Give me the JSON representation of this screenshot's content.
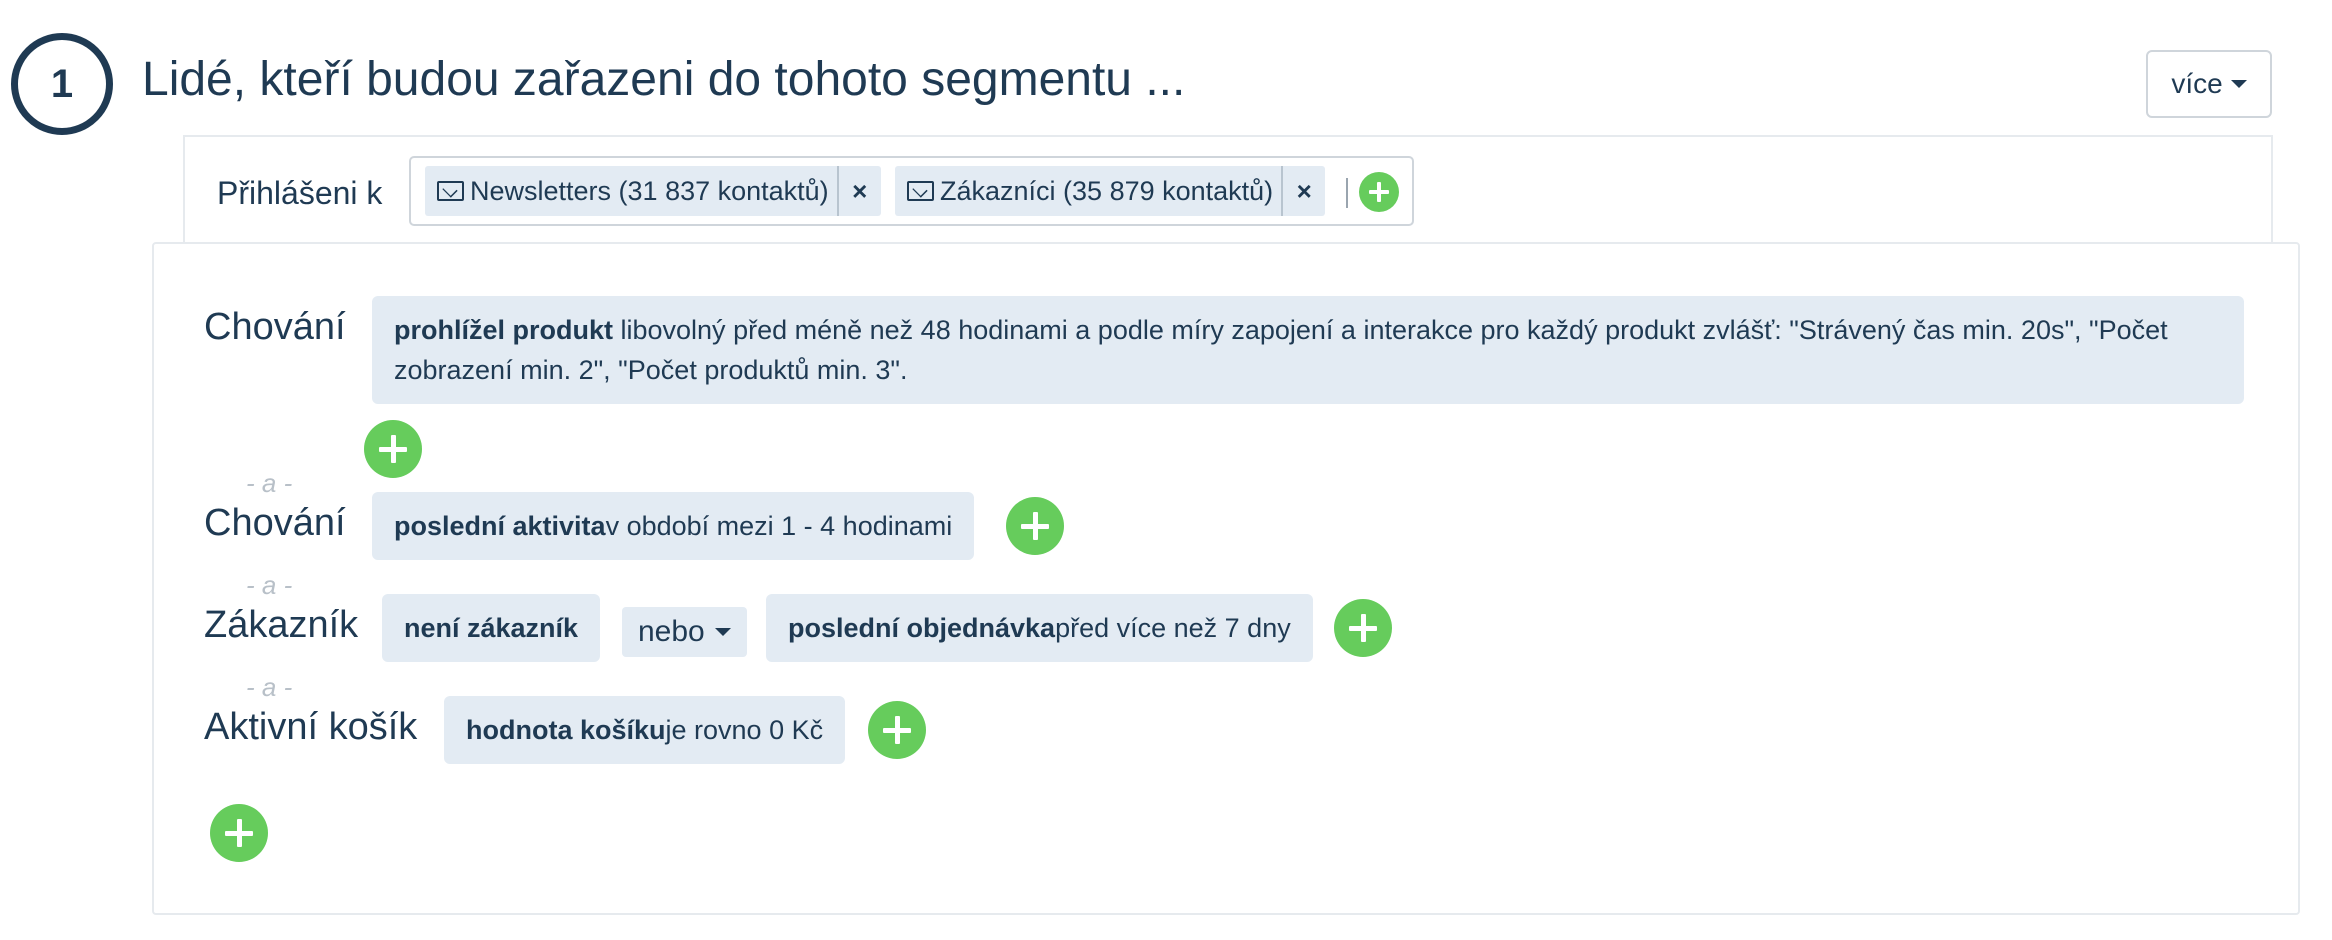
{
  "step": {
    "number": "1",
    "title": "Lidé, kteří budou zařazeni do tohoto segmentu ..."
  },
  "more_button": {
    "label": "více",
    "icon": "caret-down-icon"
  },
  "subscribed": {
    "label": "Přihlášeni k",
    "tags": [
      {
        "label": "Newsletters (31 837 kontaktů)",
        "icon": "envelope-icon",
        "remove": "×"
      },
      {
        "label": "Zákazníci (35 879 kontaktů)",
        "icon": "envelope-icon",
        "remove": "×"
      }
    ]
  },
  "conditions": [
    {
      "label": "Chování",
      "chips": [
        {
          "bold": "prohlížel produkt",
          "rest": " libovolný před méně než 48 hodinami a podle míry zapojení a interakce pro každý produkt zvlášť: \"Strávený čas min. 20s\", \"Počet zobrazení min. 2\", \"Počet produktů min. 3\"."
        }
      ]
    },
    {
      "label": "Chování",
      "chips": [
        {
          "bold": "poslední aktivita",
          "rest": " v období mezi 1 - 4 hodinami"
        }
      ]
    },
    {
      "label": "Zákazník",
      "chips": [
        {
          "bold": "není zákazník",
          "rest": ""
        },
        {
          "bold": "poslední objednávka",
          "rest": " před více než 7 dny"
        }
      ],
      "operator": "nebo"
    },
    {
      "label": "Aktivní košík",
      "chips": [
        {
          "bold": "hodnota košíku",
          "rest": " je rovno 0 Kč"
        }
      ]
    }
  ],
  "and_separator": "- a -",
  "colors": {
    "accent": "#66cc5c",
    "chip_bg": "#e3ebf3",
    "text": "#1f3a53"
  }
}
